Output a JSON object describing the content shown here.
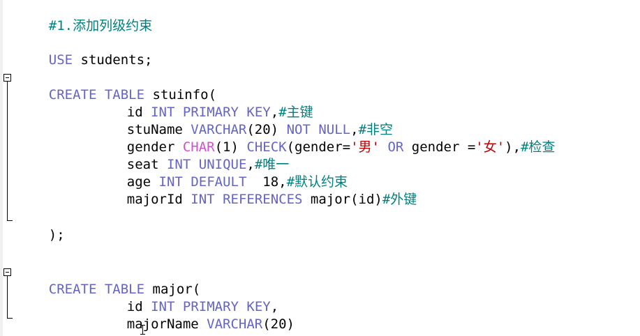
{
  "code": {
    "l1": {
      "c": "#1.添加列级约束"
    },
    "l2": {
      "k": "USE",
      "t": " students;"
    },
    "l3": {
      "k1": "CREATE",
      "s1": " ",
      "k2": "TABLE",
      "t": " stuinfo("
    },
    "l4": {
      "t1": "id ",
      "k1": "INT",
      "s1": " ",
      "k2": "PRIMARY",
      "s2": " ",
      "k3": "KEY",
      "t2": ",",
      "c": "#主键"
    },
    "l5": {
      "t1": "stuName ",
      "k1": "VARCHAR",
      "t2": "(20) ",
      "k2": "NOT",
      "s1": " ",
      "k3": "NULL",
      "t3": ",",
      "c": "#非空"
    },
    "l6": {
      "t1": "gender ",
      "f1": "CHAR",
      "t2": "(1) ",
      "k1": "CHECK",
      "t3": "(gender=",
      "str1": "'男'",
      "s1": " ",
      "k2": "OR",
      "t4": " gender =",
      "str2": "'女'",
      "t5": "),",
      "c": "#检查"
    },
    "l7": {
      "t1": "seat ",
      "k1": "INT",
      "s1": " ",
      "k2": "UNIQUE",
      "t2": ",",
      "c": "#唯一"
    },
    "l8": {
      "t1": "age ",
      "k1": "INT",
      "s1": " ",
      "k2": "DEFAULT",
      "t2": "  18,",
      "c": "#默认约束"
    },
    "l9": {
      "t1": "majorId ",
      "k1": "INT",
      "s1": " ",
      "k2": "REFERENCES",
      "t2": " major(id)",
      "c": "#外键"
    },
    "l10": {
      "t": ");"
    },
    "l11": {
      "k1": "CREATE",
      "s1": " ",
      "k2": "TABLE",
      "t": " major("
    },
    "l12": {
      "t1": "id ",
      "k1": "INT",
      "s1": " ",
      "k2": "PRIMARY",
      "s2": " ",
      "k3": "KEY",
      "t2": ","
    },
    "l13": {
      "t1": "majorName ",
      "k1": "VARCHAR",
      "t2": "(20)"
    },
    "l14": {
      "t": ");"
    }
  },
  "colors": {
    "keyword": "#6464c8",
    "function": "#d050d0",
    "string": "#c00000",
    "comment": "#008080",
    "text": "#000000"
  },
  "icons": {
    "fold": "fold-collapse-icon",
    "cursor": "text-cursor-icon"
  }
}
